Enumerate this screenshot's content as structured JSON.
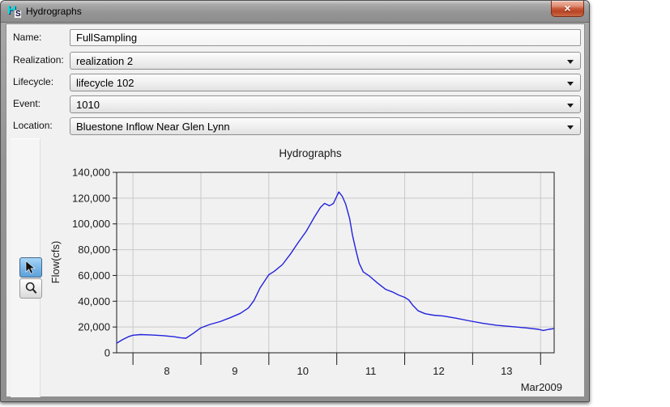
{
  "window": {
    "title": "Hydrographs"
  },
  "icons": {
    "close": "×",
    "app_h": "H",
    "app_s": "S"
  },
  "form": {
    "fields": [
      {
        "label": "Name:",
        "value": "FullSampling",
        "type": "text"
      },
      {
        "label": "Realization:",
        "value": "realization 2",
        "type": "combo"
      },
      {
        "label": "Lifecycle:",
        "value": "lifecycle 102",
        "type": "combo"
      },
      {
        "label": "Event:",
        "value": "1010",
        "type": "combo"
      },
      {
        "label": "Location:",
        "value": "Bluestone Inflow Near Glen Lynn",
        "type": "combo"
      }
    ]
  },
  "toolbar": {
    "buttons": [
      {
        "name": "pointer-tool",
        "selected": true
      },
      {
        "name": "zoom-tool",
        "selected": false
      }
    ]
  },
  "chart_data": {
    "type": "line",
    "title": "Hydrographs",
    "ylabel": "Flow(cfs)",
    "x_unit_label": "Mar2009",
    "xlim": [
      7.76,
      14.2
    ],
    "ylim": [
      0,
      140000
    ],
    "yticks": [
      0,
      20000,
      40000,
      60000,
      80000,
      100000,
      120000,
      140000
    ],
    "xticks_days": [
      8,
      9,
      10,
      11,
      12,
      13,
      14
    ],
    "xtick_labeled_days": [
      8,
      9,
      10,
      11,
      12,
      13
    ],
    "grid": true,
    "line_color": "#2222dd",
    "grid_color": "#c9c9c9",
    "series": [
      {
        "name": "Bluestone Inflow Near Glen Lynn",
        "points": [
          [
            7.76,
            7500
          ],
          [
            7.85,
            10300
          ],
          [
            7.93,
            12400
          ],
          [
            8.0,
            13600
          ],
          [
            8.11,
            14100
          ],
          [
            8.26,
            13900
          ],
          [
            8.44,
            13300
          ],
          [
            8.6,
            12500
          ],
          [
            8.7,
            11700
          ],
          [
            8.78,
            11300
          ],
          [
            8.88,
            14800
          ],
          [
            9.0,
            19400
          ],
          [
            9.13,
            22000
          ],
          [
            9.28,
            24200
          ],
          [
            9.43,
            27200
          ],
          [
            9.58,
            30600
          ],
          [
            9.7,
            34800
          ],
          [
            9.78,
            40400
          ],
          [
            9.87,
            50200
          ],
          [
            10.0,
            60600
          ],
          [
            10.08,
            63200
          ],
          [
            10.2,
            68400
          ],
          [
            10.32,
            76800
          ],
          [
            10.43,
            85400
          ],
          [
            10.55,
            94200
          ],
          [
            10.67,
            105200
          ],
          [
            10.76,
            112800
          ],
          [
            10.82,
            115900
          ],
          [
            10.89,
            114100
          ],
          [
            10.95,
            115800
          ],
          [
            11.03,
            124800
          ],
          [
            11.08,
            121500
          ],
          [
            11.13,
            115500
          ],
          [
            11.19,
            104000
          ],
          [
            11.23,
            91500
          ],
          [
            11.28,
            79800
          ],
          [
            11.33,
            69500
          ],
          [
            11.39,
            62700
          ],
          [
            11.48,
            59600
          ],
          [
            11.6,
            54100
          ],
          [
            11.72,
            49200
          ],
          [
            11.82,
            47200
          ],
          [
            11.91,
            44800
          ],
          [
            12.0,
            43000
          ],
          [
            12.06,
            41000
          ],
          [
            12.12,
            36800
          ],
          [
            12.2,
            32500
          ],
          [
            12.3,
            30300
          ],
          [
            12.42,
            29200
          ],
          [
            12.57,
            28500
          ],
          [
            12.76,
            26800
          ],
          [
            12.95,
            24800
          ],
          [
            13.16,
            22800
          ],
          [
            13.36,
            21300
          ],
          [
            13.6,
            20200
          ],
          [
            13.81,
            19200
          ],
          [
            13.97,
            18200
          ],
          [
            14.04,
            17300
          ],
          [
            14.12,
            18200
          ],
          [
            14.2,
            18800
          ]
        ]
      }
    ]
  }
}
